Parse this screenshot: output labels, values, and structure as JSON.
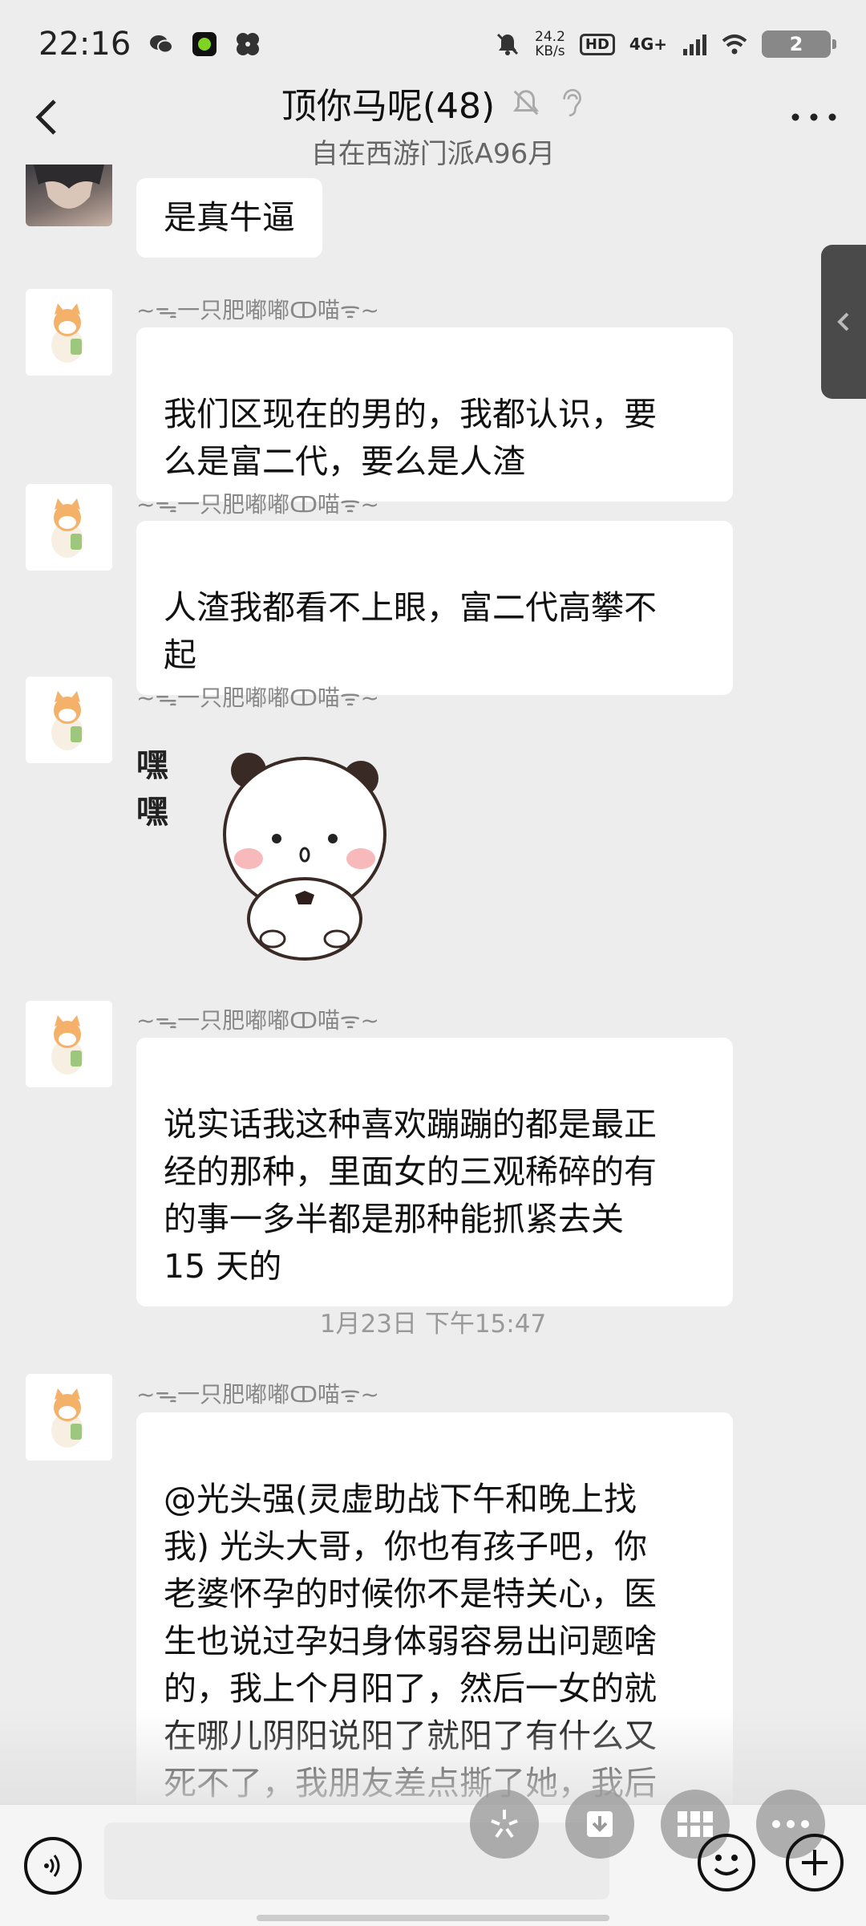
{
  "status_bar": {
    "time": "22:16",
    "speed_value": "24.2",
    "speed_unit": "KB/s",
    "hd": "HD",
    "network": "4G+",
    "battery": "2"
  },
  "header": {
    "title": "顶你马呢(48)",
    "subtitle": "自在西游门派A96月"
  },
  "messages": [
    {
      "sender": "",
      "text": "是真牛逼"
    },
    {
      "sender": "~ᯓ一只肥嘟嘟ↀ喵ᯤ~",
      "text": "我们区现在的男的，我都认识，要\n么是富二代，要么是人渣"
    },
    {
      "sender": "~ᯓ一只肥嘟嘟ↀ喵ᯤ~",
      "text": "人渣我都看不上眼，富二代高攀不\n起"
    },
    {
      "sender": "~ᯓ一只肥嘟嘟ↀ喵ᯤ~",
      "sticker_text": "嘿嘿"
    },
    {
      "sender": "~ᯓ一只肥嘟嘟ↀ喵ᯤ~",
      "text": "说实话我这种喜欢蹦蹦的都是最正\n经的那种，里面女的三观稀碎的有\n的事一多半都是那种能抓紧去关\n15 天的"
    },
    {
      "sender": "~ᯓ一只肥嘟嘟ↀ喵ᯤ~",
      "text": "@光头强(灵虚助战下午和晚上找\n我) 光头大哥，你也有孩子吧，你\n老婆怀孕的时候你不是特关心，医\n生也说过孕妇身体弱容易出问题啥\n的，我上个月阳了，然后一女的就\n在哪儿阴阳说阳了就阳了有什么又\n死不了，我朋友差点撕了她，我后\n来把我弟拉进去了，她屁都不敢放"
    }
  ],
  "timestamp": "1月23日 下午15:47",
  "icons": {
    "back": "chevron-left-icon",
    "mute": "bell-off-icon",
    "ear": "ear-icon",
    "more": "more-dots-icon",
    "side": "chevron-left-icon",
    "voice": "voice-icon",
    "emoji": "emoji-icon",
    "plus": "plus-icon"
  }
}
